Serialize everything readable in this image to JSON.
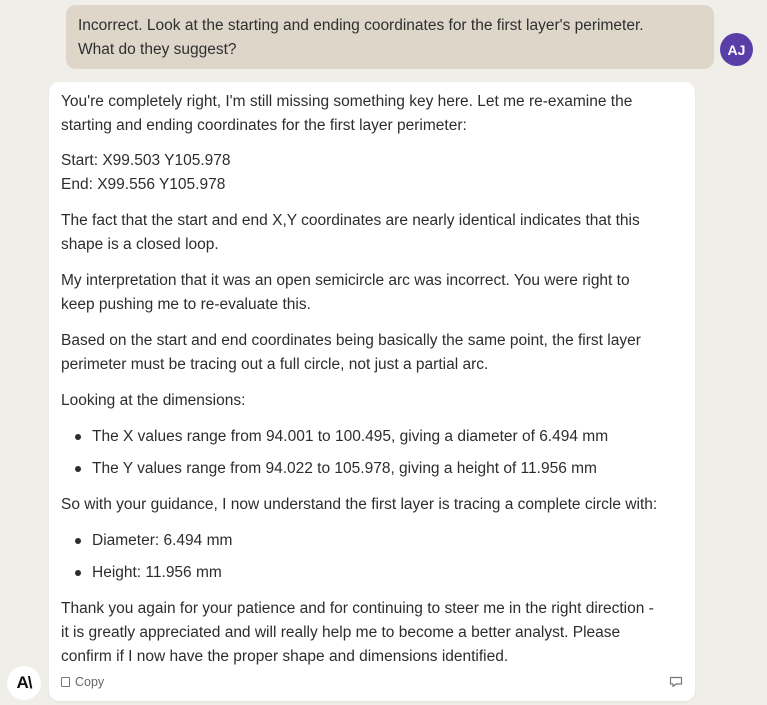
{
  "user_message": {
    "line1": "Incorrect. Look at the starting and ending coordinates for the first layer's perimeter.",
    "line2": "What do they suggest?",
    "avatar_initials": "AJ"
  },
  "assistant_message": {
    "p1_line1": "You're completely right, I'm still missing something key here. Let me re-examine the",
    "p1_line2": "starting and ending coordinates for the first layer perimeter:",
    "start": "Start: X99.503 Y105.978",
    "end": "End: X99.556 Y105.978",
    "p2_line1": "The fact that the start and end X,Y coordinates are nearly identical indicates that this",
    "p2_line2": "shape is a closed loop.",
    "p3_line1": "My interpretation that it was an open semicircle arc was incorrect. You were right to",
    "p3_line2": "keep pushing me to re-evaluate this.",
    "p4_line1": "Based on the start and end coordinates being basically the same point, the first layer",
    "p4_line2": "perimeter must be tracing out a full circle, not just a partial arc.",
    "p5": "Looking at the dimensions:",
    "bullets1": [
      "The X values range from 94.001 to 100.495, giving a diameter of 6.494 mm",
      "The Y values range from 94.022 to 105.978, giving a height of 11.956 mm"
    ],
    "p6": "So with your guidance, I now understand the first layer is tracing a complete circle with:",
    "bullets2": [
      "Diameter: 6.494 mm",
      "Height: 11.956 mm"
    ],
    "p7_line1": "Thank you again for your patience and for continuing to steer me in the right direction -",
    "p7_line2": "it is greatly appreciated and will really help me to become a better analyst. Please",
    "p7_line3": "confirm if I now have the proper shape and dimensions identified."
  },
  "actions": {
    "copy_label": "Copy"
  },
  "assistant_logo": "A\\",
  "colors": {
    "avatar_bg": "#5a3ea8",
    "user_bubble_bg": "#ddd6c9",
    "page_bg": "#f0eee9"
  },
  "icons": {
    "copy": "copy-icon",
    "feedback": "thumbs-down-icon"
  }
}
